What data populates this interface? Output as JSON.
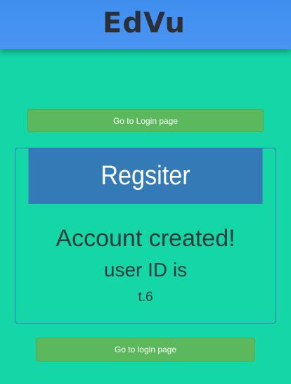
{
  "header": {
    "brand": "EdVu"
  },
  "buttons": {
    "top_label": "Go to Login page",
    "bottom_label": "Go to login page"
  },
  "panel": {
    "title": "Regsiter",
    "message": "Account created!",
    "user_id_label": "user ID is",
    "user_id_value": "t.6"
  },
  "colors": {
    "background": "#14d6a6",
    "navbar": "#4a94f2",
    "panel_heading": "#337ab7",
    "button": "#5cb85c"
  }
}
